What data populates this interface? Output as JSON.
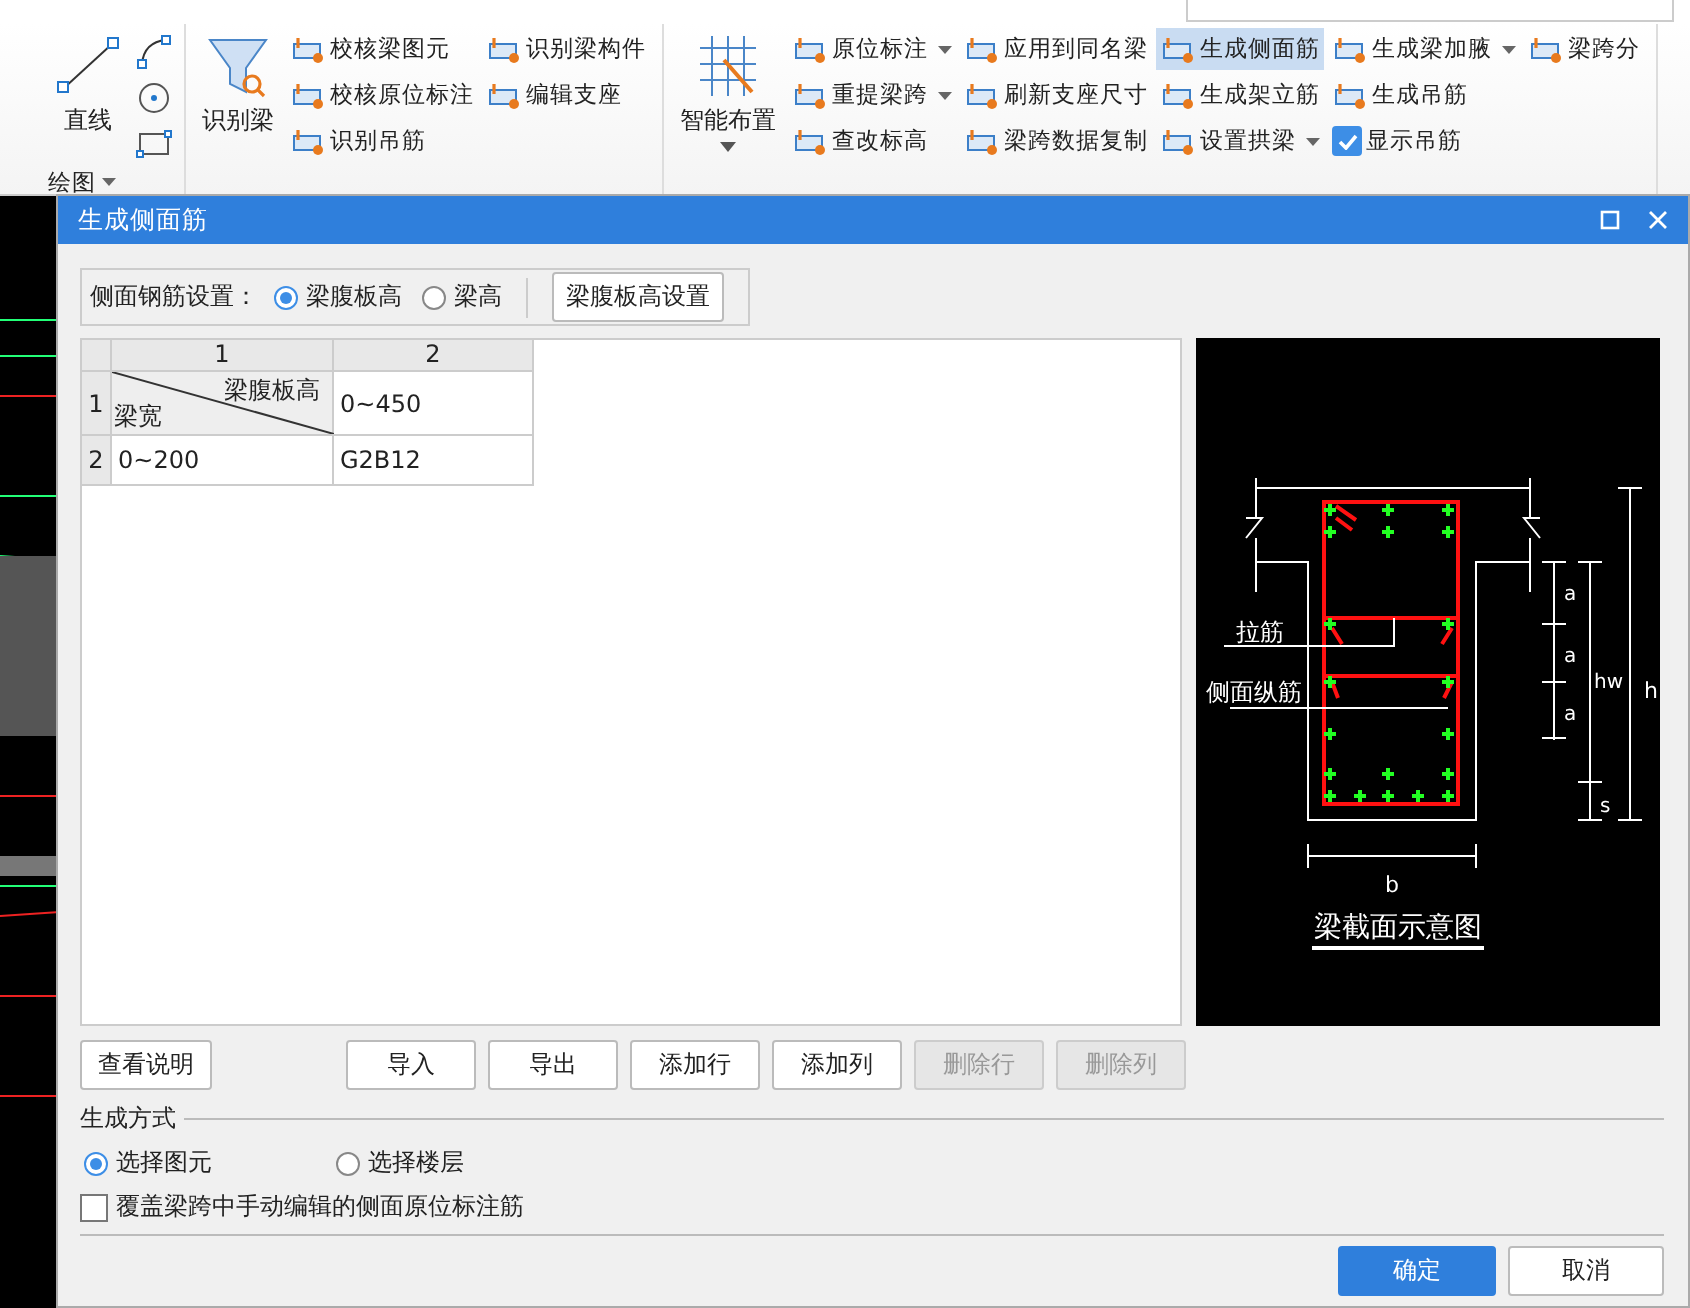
{
  "ribbon": [
    {
      "label": "绘图",
      "menu": true,
      "large": [
        {
          "label": "直线",
          "menu": false
        }
      ]
    },
    {
      "large": [
        {
          "label": "识别梁",
          "menu": false
        }
      ],
      "small": [
        {
          "label": "校核梁图元",
          "kind": "button",
          "menu": false,
          "selected": false
        },
        {
          "label": "校核原位标注",
          "kind": "button",
          "menu": false,
          "selected": false
        },
        {
          "label": "识别吊筋",
          "kind": "button",
          "menu": false,
          "selected": false
        },
        {
          "label": "识别梁构件",
          "kind": "button",
          "menu": false,
          "selected": false
        },
        {
          "label": "编辑支座",
          "kind": "button",
          "menu": false,
          "selected": false
        }
      ]
    },
    {
      "large": [
        {
          "label": "智能布置",
          "menu": true
        }
      ],
      "small": [
        {
          "label": "原位标注",
          "kind": "button",
          "menu": true,
          "selected": false
        },
        {
          "label": "重提梁跨",
          "kind": "button",
          "menu": true,
          "selected": false
        },
        {
          "label": "查改标高",
          "kind": "button",
          "menu": false,
          "selected": false
        },
        {
          "label": "应用到同名梁",
          "kind": "button",
          "menu": false,
          "selected": false
        },
        {
          "label": "刷新支座尺寸",
          "kind": "button",
          "menu": false,
          "selected": false
        },
        {
          "label": "梁跨数据复制",
          "kind": "button",
          "menu": false,
          "selected": false
        },
        {
          "label": "生成侧面筋",
          "kind": "button",
          "menu": false,
          "selected": true
        },
        {
          "label": "生成架立筋",
          "kind": "button",
          "menu": false,
          "selected": false
        },
        {
          "label": "设置拱梁",
          "kind": "button",
          "menu": true,
          "selected": false
        },
        {
          "label": "生成梁加腋",
          "kind": "button",
          "menu": true,
          "selected": false
        },
        {
          "label": "生成吊筋",
          "kind": "button",
          "menu": false,
          "selected": false
        },
        {
          "label": "显示吊筋",
          "kind": "check",
          "checked": true
        },
        {
          "label": "梁跨分",
          "kind": "button",
          "menu": false,
          "selected": false
        }
      ]
    }
  ],
  "dialog": {
    "title": "生成侧面筋",
    "setting_label": "侧面钢筋设置：",
    "setting_options": [
      {
        "label": "梁腹板高",
        "selected": true
      },
      {
        "label": "梁高",
        "selected": false
      }
    ],
    "setting_button": "梁腹板高设置",
    "table": {
      "columns": [
        "1",
        "2"
      ],
      "row_numbers": [
        "1",
        "2"
      ],
      "corner": {
        "top": "梁腹板高",
        "bottom": "梁宽"
      },
      "rows": [
        [
          "0~450"
        ],
        [
          "0~200",
          "G2B12"
        ]
      ]
    },
    "diagram": {
      "tie_label": "拉筋",
      "side_label": "侧面纵筋",
      "a_labels": [
        "a",
        "a",
        "a"
      ],
      "hw": "hw",
      "h": "h",
      "s": "s",
      "b": "b",
      "caption": "梁截面示意图"
    },
    "left_button": "查看说明",
    "table_buttons": [
      {
        "label": "导入",
        "disabled": false
      },
      {
        "label": "导出",
        "disabled": false
      },
      {
        "label": "添加行",
        "disabled": false
      },
      {
        "label": "添加列",
        "disabled": false
      },
      {
        "label": "删除行",
        "disabled": true
      },
      {
        "label": "删除列",
        "disabled": true
      }
    ],
    "mode_title": "生成方式",
    "mode_options": [
      {
        "label": "选择图元",
        "selected": true
      },
      {
        "label": "选择楼层",
        "selected": false
      }
    ],
    "override": {
      "label": "覆盖梁跨中手动编辑的侧面原位标注筋",
      "checked": false
    },
    "ok": "确定",
    "cancel": "取消"
  }
}
